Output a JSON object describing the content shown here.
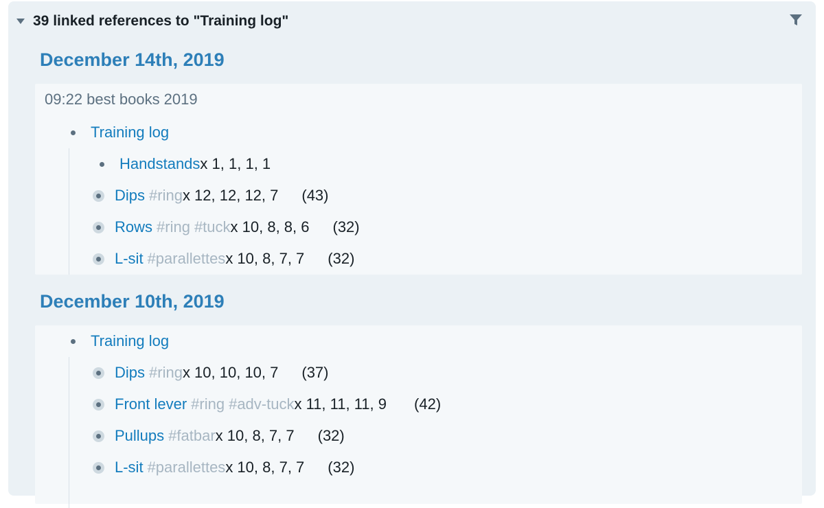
{
  "header": {
    "title": "39 linked references to \"Training log\""
  },
  "groups": [
    {
      "date": "December 14th, 2019",
      "breadcrumb": "09:22 best books 2019",
      "parent": "Training log",
      "items": [
        {
          "name": "Handstands",
          "tags": [],
          "sets": " x 1, 1, 1, 1",
          "total": ""
        },
        {
          "name": "Dips",
          "tags": [
            "#ring"
          ],
          "sets": " x 12, 12, 12, 7",
          "total": "(43)"
        },
        {
          "name": "Rows",
          "tags": [
            "#ring",
            "#tuck"
          ],
          "sets": " x 10, 8, 8, 6",
          "total": "(32)"
        },
        {
          "name": "L-sit",
          "tags": [
            "#parallettes"
          ],
          "sets": " x 10, 8, 7, 7",
          "total": "(32)"
        }
      ]
    },
    {
      "date": "December 10th, 2019",
      "parent": "Training log",
      "items": [
        {
          "name": "Dips",
          "tags": [
            "#ring"
          ],
          "sets": " x 10, 10, 10, 7",
          "total": "(37)"
        },
        {
          "name": "Front lever",
          "tags": [
            "#ring",
            "#adv-tuck"
          ],
          "sets": " x 11, 11, 11, 9",
          "total": "(42)"
        },
        {
          "name": "Pullups",
          "tags": [
            "#fatbar"
          ],
          "sets": " x 10, 8, 7, 7",
          "total": "(32)"
        },
        {
          "name": "L-sit",
          "tags": [
            "#parallettes"
          ],
          "sets": " x 10, 8, 7, 7",
          "total": "(32)"
        }
      ]
    }
  ]
}
